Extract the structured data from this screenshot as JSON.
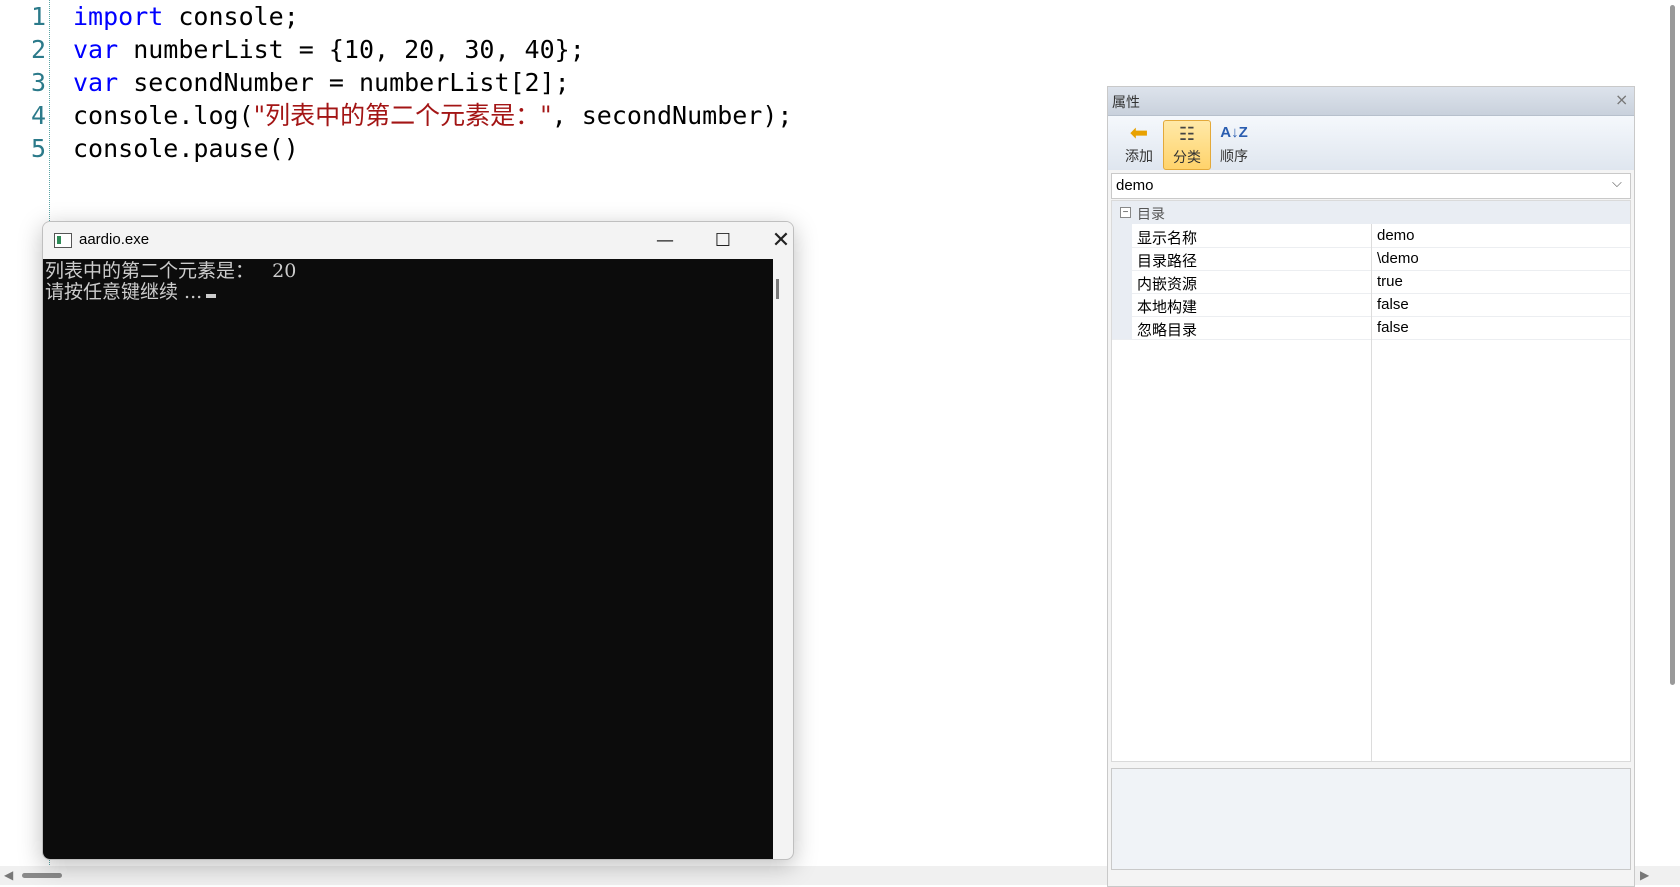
{
  "editor": {
    "line_numbers": [
      "1",
      "2",
      "3",
      "4",
      "5"
    ],
    "lines": [
      {
        "kw": "import",
        "rest": " console;"
      },
      {
        "kw": "var",
        "rest": " numberList = {10, 20, 30, 40};"
      },
      {
        "kw": "var",
        "rest": " secondNumber = numberList[2];"
      },
      {
        "pre": "console.log(",
        "str": "\"列表中的第二个元素是：\"",
        "post": ", secondNumber);"
      },
      {
        "plain": "console.pause()"
      }
    ]
  },
  "console_window": {
    "title": "aardio.exe",
    "minimize_glyph": "—",
    "maximize_glyph": "☐",
    "close_glyph": "✕",
    "output_lines": [
      "列表中的第二个元素是：   20",
      "请按任意键继续 ..."
    ]
  },
  "properties_panel": {
    "title": "属性",
    "close_glyph": "×",
    "toolbar": [
      {
        "label": "添加",
        "icon": "arrow-left-icon"
      },
      {
        "label": "分类",
        "icon": "categorized-icon",
        "active": true
      },
      {
        "label": "顺序",
        "icon": "sort-az-icon"
      }
    ],
    "object_selector": "demo",
    "category": "目录",
    "rows": [
      {
        "name": "显示名称",
        "value": "demo"
      },
      {
        "name": "目录路径",
        "value": "\\demo"
      },
      {
        "name": "内嵌资源",
        "value": "true"
      },
      {
        "name": "本地构建",
        "value": "false"
      },
      {
        "name": "忽略目录",
        "value": "false"
      }
    ]
  },
  "colors": {
    "keyword": "#0000ff",
    "string": "#a31515",
    "line_number": "#2b7a8a",
    "console_bg": "#0c0c0c",
    "console_text": "#cccccc",
    "toolbar_active": "#ffd36b"
  }
}
